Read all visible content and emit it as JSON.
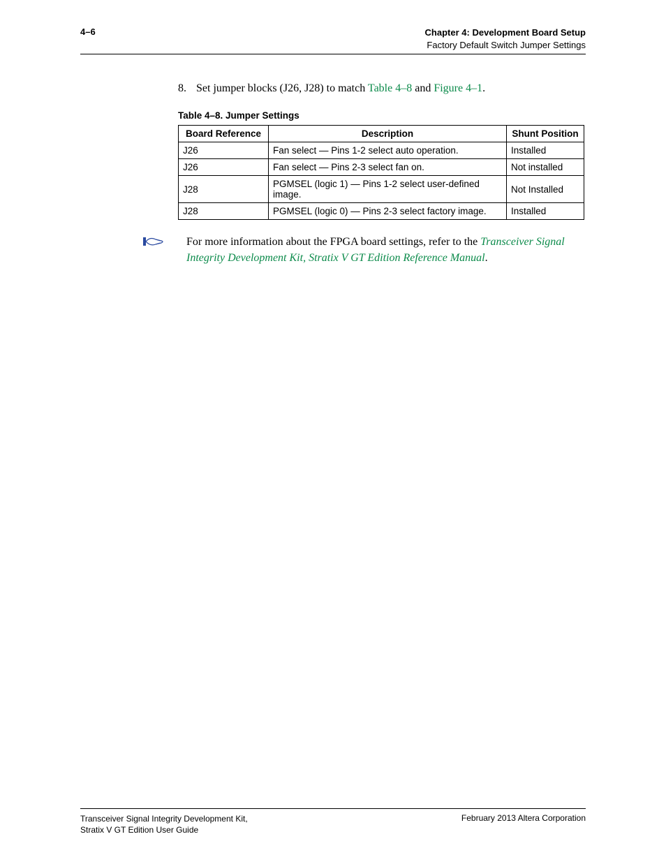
{
  "header": {
    "page_number": "4–6",
    "chapter_prefix": "Chapter 4:",
    "chapter_title": "Development Board Setup",
    "section": "Factory Default Switch Jumper Settings"
  },
  "step": {
    "number": "8.",
    "text_before": "Set jumper blocks (J26, J28) to match ",
    "link_table": "Table 4–8",
    "text_mid": " and ",
    "link_figure": "Figure 4–1",
    "text_after": "."
  },
  "table": {
    "caption": "Table 4–8.  Jumper Settings",
    "headers": {
      "ref": "Board Reference",
      "desc": "Description",
      "shunt": "Shunt Position"
    },
    "rows": [
      {
        "ref": "J26",
        "desc": "Fan select — Pins 1-2 select auto operation.",
        "shunt": "Installed"
      },
      {
        "ref": "J26",
        "desc": "Fan select — Pins 2-3 select fan on.",
        "shunt": "Not installed"
      },
      {
        "ref": "J28",
        "desc": "PGMSEL (logic 1) — Pins 1-2 select user-defined image.",
        "shunt": "Not Installed"
      },
      {
        "ref": "J28",
        "desc": "PGMSEL (logic 0) — Pins 2-3 select factory image.",
        "shunt": "Installed"
      }
    ]
  },
  "note": {
    "text_before": "For more information about the FPGA board settings, refer to the ",
    "link_text": "Transceiver Signal Integrity Development Kit, Stratix V GT Edition Reference Manual",
    "text_after": "."
  },
  "footer": {
    "left_line1": "Transceiver Signal Integrity Development Kit,",
    "left_line2": "Stratix V GT Edition User Guide",
    "right": "February 2013    Altera Corporation"
  }
}
